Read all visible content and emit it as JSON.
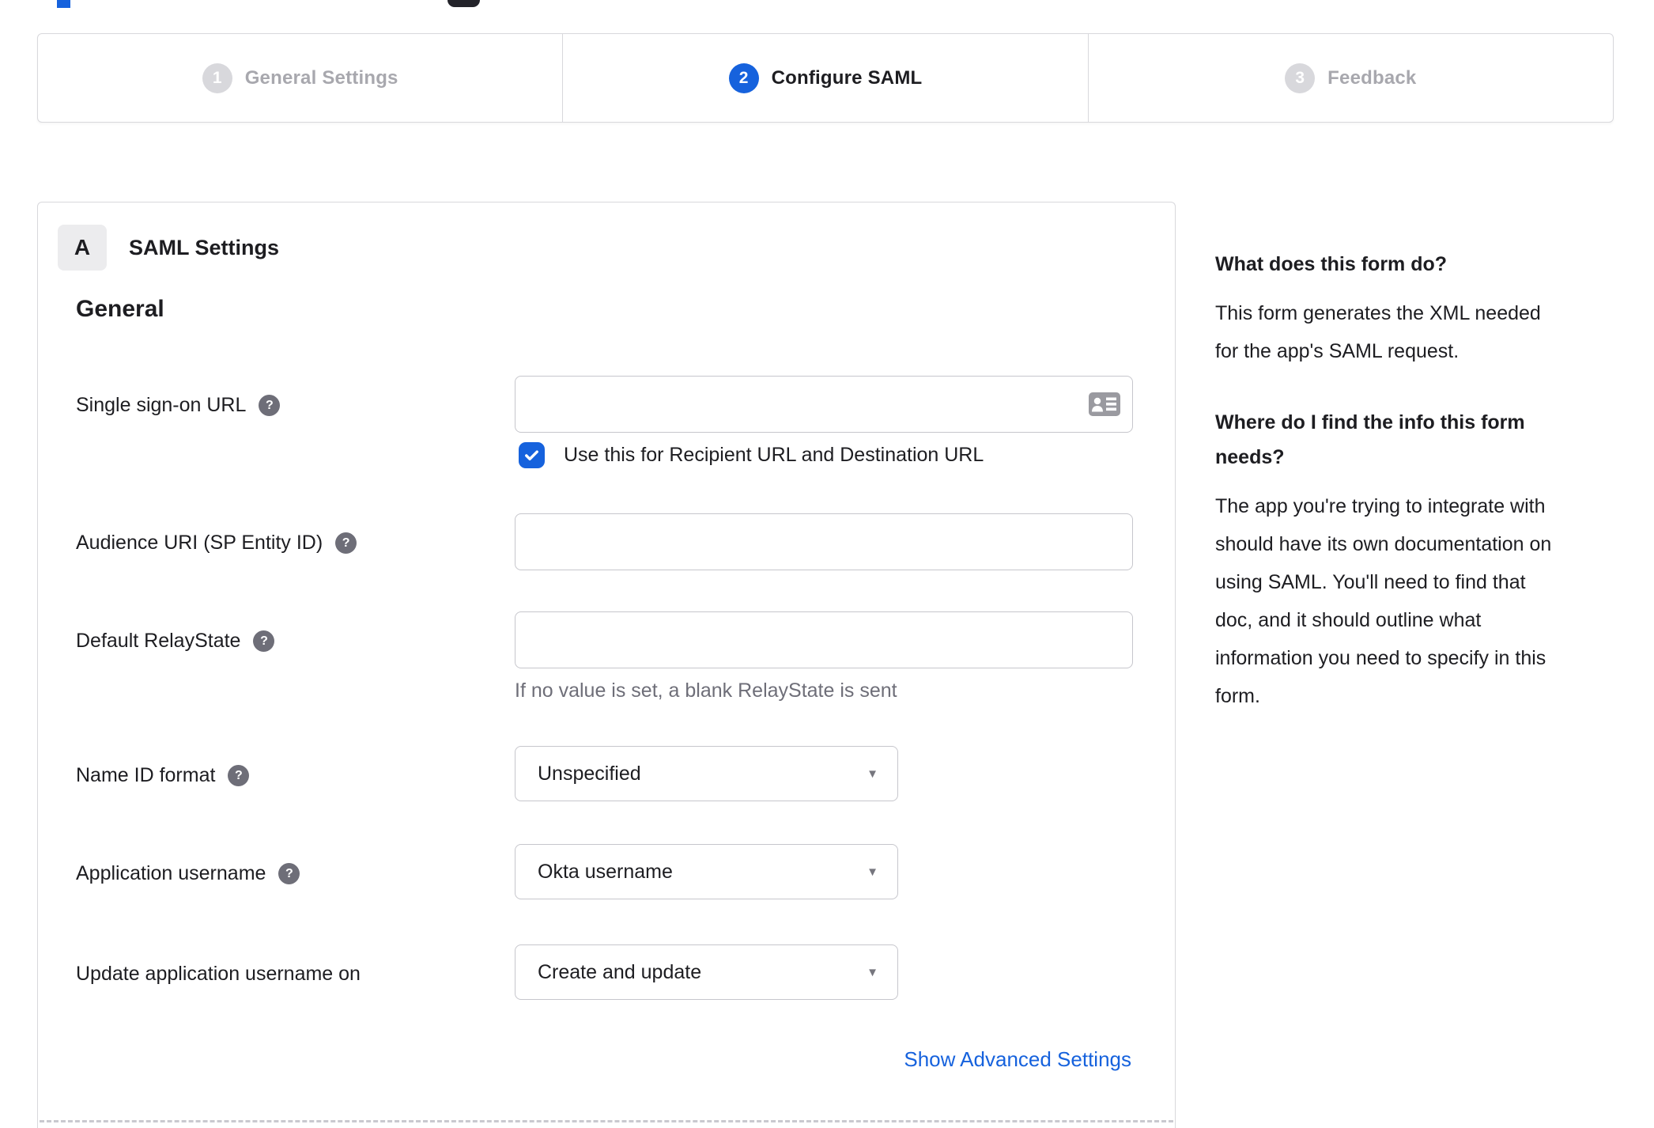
{
  "colors": {
    "accent_blue": "#1662dd",
    "inactive_gray": "#d8d8dc",
    "text_dark": "#1d1d21",
    "hint_gray": "#6e6e78"
  },
  "wizard": {
    "active_step": 2,
    "steps": [
      {
        "number": "1",
        "label": "General Settings"
      },
      {
        "number": "2",
        "label": "Configure SAML"
      },
      {
        "number": "3",
        "label": "Feedback"
      }
    ]
  },
  "panel": {
    "badge": "A",
    "title": "SAML Settings",
    "section_heading": "General",
    "sso": {
      "label": "Single sign-on URL",
      "value": "",
      "checkbox_checked": true,
      "checkbox_label": "Use this for Recipient URL and Destination URL"
    },
    "audience": {
      "label": "Audience URI (SP Entity ID)",
      "value": ""
    },
    "relay": {
      "label": "Default RelayState",
      "value": "",
      "hint": "If no value is set, a blank RelayState is sent"
    },
    "name_id": {
      "label": "Name ID format",
      "value": "Unspecified"
    },
    "app_username": {
      "label": "Application username",
      "value": "Okta username"
    },
    "update_username": {
      "label": "Update application username on",
      "value": "Create and update"
    },
    "advanced_link": "Show Advanced Settings"
  },
  "sidebar": {
    "q1": "What does this form do?",
    "a1": "This form generates the XML needed\nfor the app's SAML request.",
    "q2": "Where do I find the info this form\nneeds?",
    "a2": "The app you're trying to integrate with\nshould have its own documentation on\nusing SAML. You'll need to find that\ndoc, and it should outline what\ninformation you need to specify in this\nform."
  }
}
